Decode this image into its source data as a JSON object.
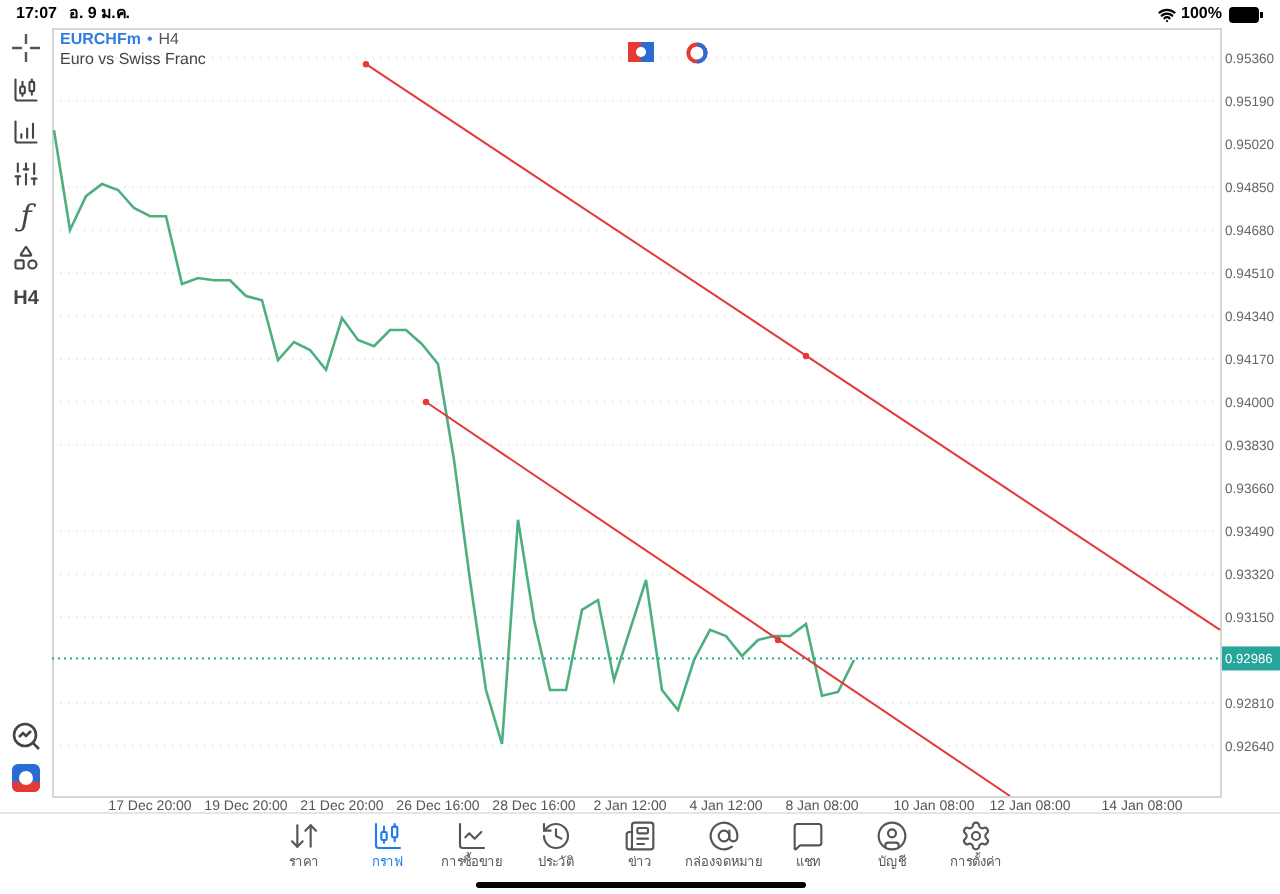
{
  "status_bar": {
    "time": "17:07",
    "date": "อ. 9 ม.ค.",
    "battery": "100%"
  },
  "toolbar": {
    "function_symbol": "ƒ",
    "timeframe": "H4"
  },
  "chart": {
    "symbol": "EURCHFm",
    "separator": "•",
    "timeframe": "H4",
    "description": "Euro vs Swiss Franc",
    "current_price": "0.92986",
    "chart_data": {
      "type": "line",
      "categories": [
        null,
        null,
        null,
        null,
        null,
        null,
        "17 Dec 20:00",
        null,
        null,
        null,
        null,
        null,
        "19 Dec 20:00",
        null,
        null,
        null,
        null,
        null,
        "21 Dec 20:00",
        null,
        null,
        null,
        null,
        null,
        "26 Dec 16:00",
        null,
        null,
        null,
        null,
        null,
        "28 Dec 16:00",
        null,
        null,
        null,
        null,
        null,
        "2 Jan 12:00",
        null,
        null,
        null,
        null,
        null,
        "4 Jan 12:00",
        null,
        null,
        null,
        null,
        null,
        "8 Jan 08:00",
        null,
        null,
        null,
        null,
        null,
        null,
        "10 Jan 08:00",
        null,
        null,
        null,
        null,
        null,
        "12 Jan 08:00",
        null,
        null,
        null,
        null,
        null,
        null,
        "14 Jan 08:00",
        null,
        null,
        null,
        null
      ],
      "series": [
        {
          "color": "#4caf7d",
          "values": [
            0.95075,
            0.9468,
            0.94814,
            0.94862,
            0.94838,
            0.94767,
            0.94735,
            0.94735,
            0.94467,
            0.9449,
            0.94482,
            0.94482,
            0.94419,
            0.94403,
            0.94166,
            0.94237,
            0.94206,
            0.94127,
            0.94332,
            0.94245,
            0.94221,
            0.94285,
            0.94285,
            0.94229,
            0.9415,
            0.93771,
            0.93296,
            0.92861,
            0.92648,
            0.93534,
            0.93138,
            0.92861,
            0.92861,
            0.93178,
            0.93217,
            0.92901,
            0.93099,
            0.93296,
            0.92861,
            0.92782,
            0.9298,
            0.93099,
            0.93075,
            0.92996,
            0.93059,
            0.93075,
            0.93075,
            0.93122,
            0.92838,
            0.92853,
            0.9298,
            null,
            null,
            null,
            null,
            null,
            null,
            null,
            null,
            null,
            null,
            null,
            null,
            null,
            null,
            null,
            null,
            null,
            null,
            null,
            null,
            null,
            null
          ]
        }
      ],
      "ylim": [
        0.92442,
        0.95479
      ],
      "grid": true,
      "yticks": [
        {
          "value": 0.9536,
          "label": "0.95360"
        },
        {
          "value": 0.9519,
          "label": "0.95190"
        },
        {
          "value": 0.9502,
          "label": "0.95020"
        },
        {
          "value": 0.9485,
          "label": "0.94850"
        },
        {
          "value": 0.9468,
          "label": "0.94680"
        },
        {
          "value": 0.9451,
          "label": "0.94510"
        },
        {
          "value": 0.9434,
          "label": "0.94340"
        },
        {
          "value": 0.9417,
          "label": "0.94170"
        },
        {
          "value": 0.94,
          "label": "0.94000"
        },
        {
          "value": 0.9383,
          "label": "0.93830"
        },
        {
          "value": 0.9366,
          "label": "0.93660"
        },
        {
          "value": 0.9349,
          "label": "0.93490"
        },
        {
          "value": 0.9332,
          "label": "0.93320"
        },
        {
          "value": 0.9315,
          "label": "0.93150"
        },
        {
          "value": 0.9281,
          "label": "0.92810"
        },
        {
          "value": 0.9264,
          "label": "0.92640"
        }
      ]
    }
  },
  "tabs": [
    {
      "kind": "quotes",
      "label": "ราคา",
      "selected": false
    },
    {
      "kind": "chart",
      "label": "กราฟ",
      "selected": true
    },
    {
      "kind": "trade",
      "label": "การซื้อขาย",
      "selected": false
    },
    {
      "kind": "history",
      "label": "ประวัติ",
      "selected": false
    },
    {
      "kind": "news",
      "label": "ข่าว",
      "selected": false
    },
    {
      "kind": "mail",
      "label": "กล่องจดหมาย",
      "selected": false
    },
    {
      "kind": "chat",
      "label": "แชท",
      "selected": false
    },
    {
      "kind": "account",
      "label": "บัญชี",
      "selected": false
    },
    {
      "kind": "settings",
      "label": "การตั้งค่า",
      "selected": false
    }
  ]
}
